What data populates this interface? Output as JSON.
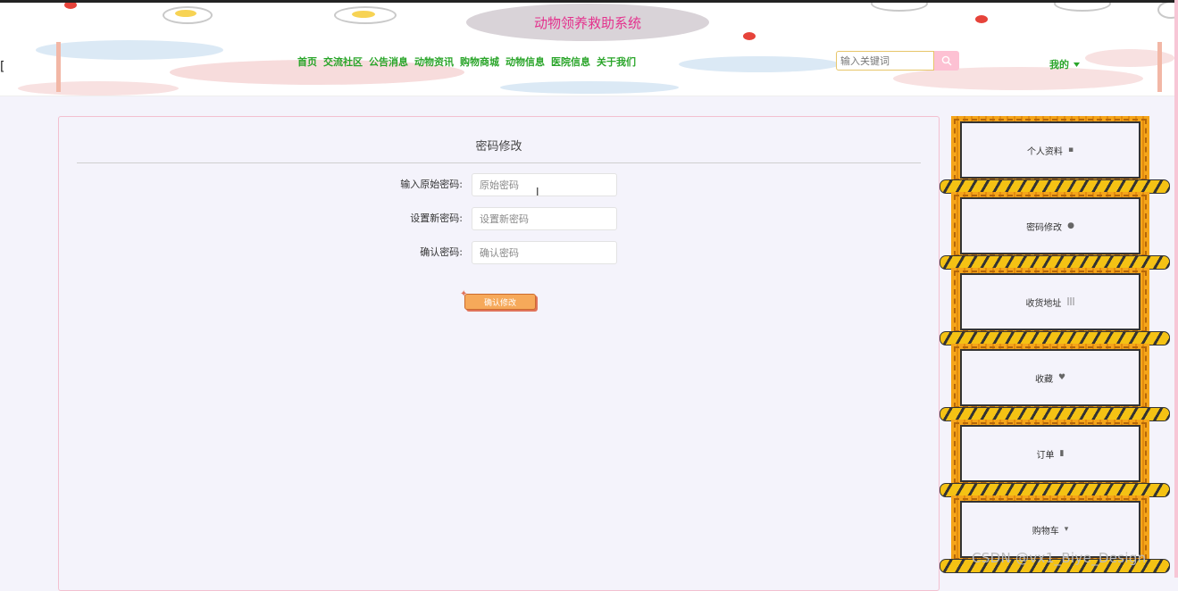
{
  "header": {
    "site_title": "动物领养救助系统",
    "left_clip_text": "[",
    "nav": [
      "首页",
      "交流社区",
      "公告消息",
      "动物资讯",
      "购物商城",
      "动物信息",
      "医院信息",
      "关于我们"
    ],
    "search_placeholder": "输入关键词",
    "mine_label": "我的"
  },
  "form": {
    "title": "密码修改",
    "fields": [
      {
        "label": "输入原始密码:",
        "placeholder": "原始密码"
      },
      {
        "label": "设置新密码:",
        "placeholder": "设置新密码"
      },
      {
        "label": "确认密码:",
        "placeholder": "确认密码"
      }
    ],
    "submit_label": "确认修改"
  },
  "sidebar": {
    "items": [
      {
        "label": "个人资料",
        "icon": "briefcase-icon"
      },
      {
        "label": "密码修改",
        "icon": "user-icon"
      },
      {
        "label": "收货地址",
        "icon": "barcode-icon"
      },
      {
        "label": "收藏",
        "icon": "heart-icon"
      },
      {
        "label": "订单",
        "icon": "document-icon"
      },
      {
        "label": "购物车",
        "icon": "cart-icon"
      }
    ]
  },
  "watermark": "CSDN @vx1_Biye_Design",
  "colors": {
    "accent_green": "#2aa52a",
    "title_pink": "#e4318d",
    "sidebar_orange": "#f5a51a",
    "stripe_yellow": "#f4c214"
  }
}
